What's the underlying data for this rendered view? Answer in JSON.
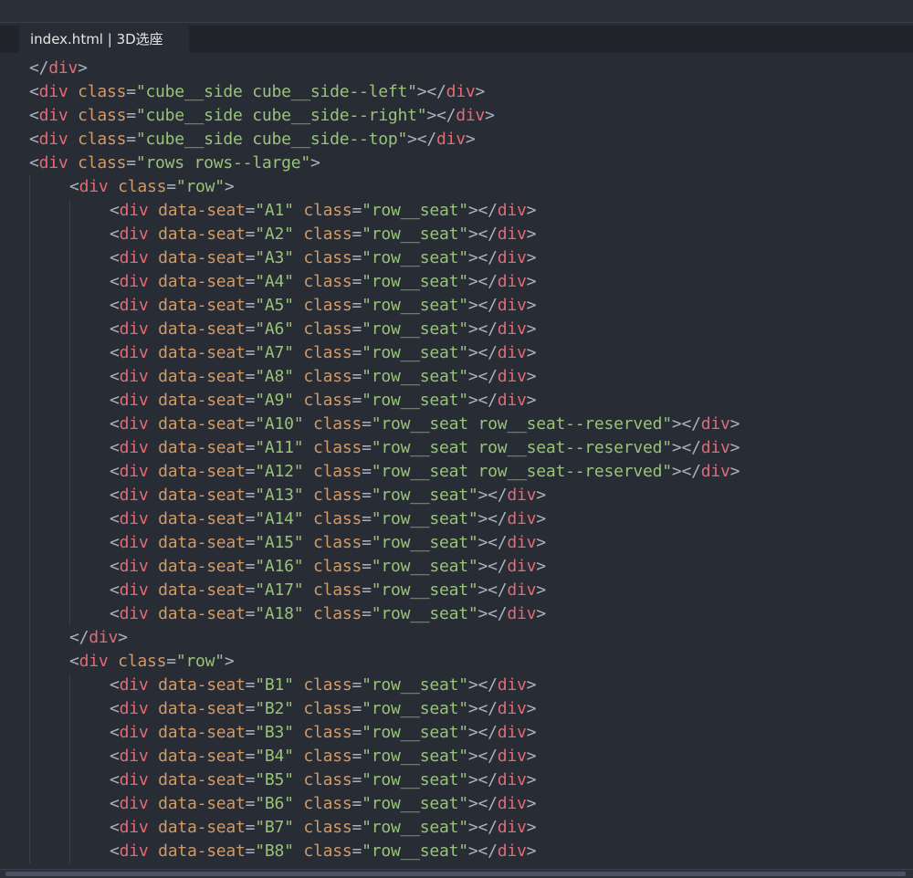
{
  "tab": {
    "label": "index.html | 3D选座"
  },
  "code": {
    "lines": [
      "</div>",
      "<div class=\"cube__side cube__side--left\"></div>",
      "<div class=\"cube__side cube__side--right\"></div>",
      "<div class=\"cube__side cube__side--top\"></div>",
      "<div class=\"rows rows--large\">",
      "<div class=\"row\">",
      "<div data-seat=\"A1\" class=\"row__seat\"></div>",
      "<div data-seat=\"A2\" class=\"row__seat\"></div>",
      "<div data-seat=\"A3\" class=\"row__seat\"></div>",
      "<div data-seat=\"A4\" class=\"row__seat\"></div>",
      "<div data-seat=\"A5\" class=\"row__seat\"></div>",
      "<div data-seat=\"A6\" class=\"row__seat\"></div>",
      "<div data-seat=\"A7\" class=\"row__seat\"></div>",
      "<div data-seat=\"A8\" class=\"row__seat\"></div>",
      "<div data-seat=\"A9\" class=\"row__seat\"></div>",
      "<div data-seat=\"A10\" class=\"row__seat row__seat--reserved\"></div>",
      "<div data-seat=\"A11\" class=\"row__seat row__seat--reserved\"></div>",
      "<div data-seat=\"A12\" class=\"row__seat row__seat--reserved\"></div>",
      "<div data-seat=\"A13\" class=\"row__seat\"></div>",
      "<div data-seat=\"A14\" class=\"row__seat\"></div>",
      "<div data-seat=\"A15\" class=\"row__seat\"></div>",
      "<div data-seat=\"A16\" class=\"row__seat\"></div>",
      "<div data-seat=\"A17\" class=\"row__seat\"></div>",
      "<div data-seat=\"A18\" class=\"row__seat\"></div>",
      "</div>",
      "<div class=\"row\">",
      "<div data-seat=\"B1\" class=\"row__seat\"></div>",
      "<div data-seat=\"B2\" class=\"row__seat\"></div>",
      "<div data-seat=\"B3\" class=\"row__seat\"></div>",
      "<div data-seat=\"B4\" class=\"row__seat\"></div>",
      "<div data-seat=\"B5\" class=\"row__seat\"></div>",
      "<div data-seat=\"B6\" class=\"row__seat\"></div>",
      "<div data-seat=\"B7\" class=\"row__seat\"></div>",
      "<div data-seat=\"B8\" class=\"row__seat\"></div>"
    ]
  },
  "colors": {
    "background": "#282c34",
    "tag": "#e06c75",
    "attribute": "#d19a66",
    "string": "#98c379",
    "punctuation": "#abb2bf"
  }
}
